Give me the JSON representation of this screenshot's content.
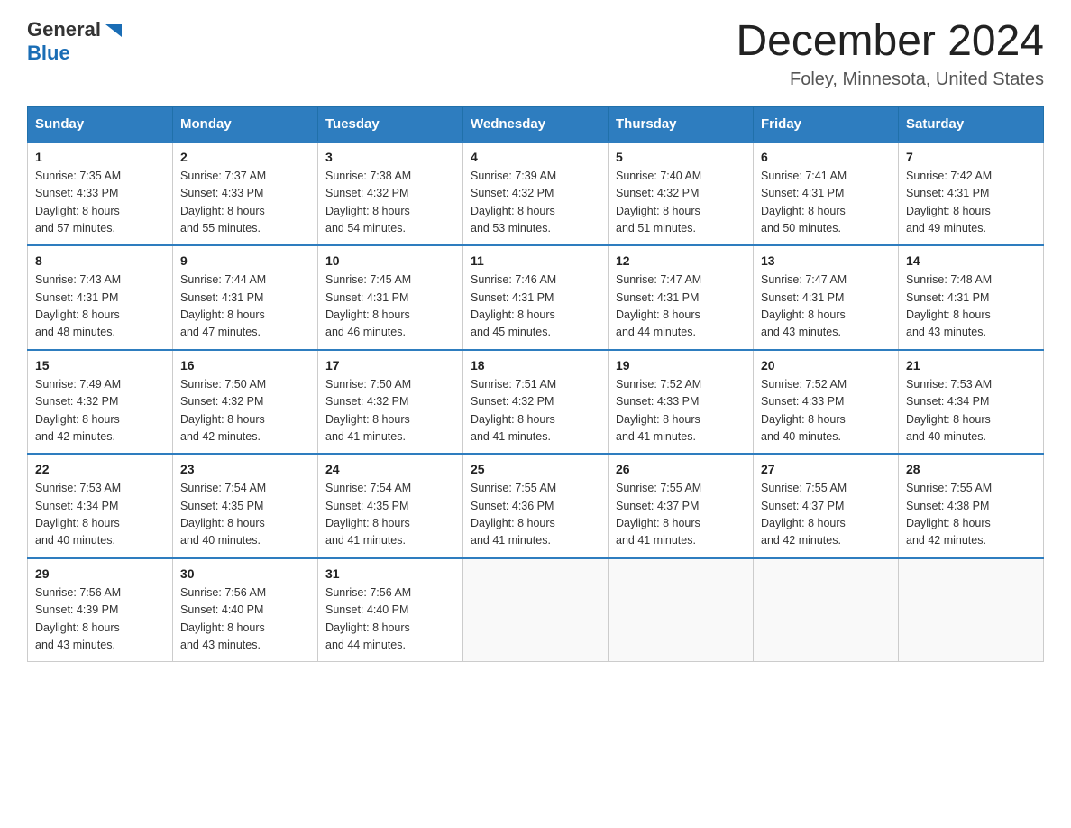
{
  "header": {
    "logo": {
      "general": "General",
      "blue": "Blue"
    },
    "month_title": "December 2024",
    "location": "Foley, Minnesota, United States"
  },
  "days_of_week": [
    "Sunday",
    "Monday",
    "Tuesday",
    "Wednesday",
    "Thursday",
    "Friday",
    "Saturday"
  ],
  "weeks": [
    [
      {
        "day": "1",
        "sunrise": "7:35 AM",
        "sunset": "4:33 PM",
        "daylight": "8 hours and 57 minutes."
      },
      {
        "day": "2",
        "sunrise": "7:37 AM",
        "sunset": "4:33 PM",
        "daylight": "8 hours and 55 minutes."
      },
      {
        "day": "3",
        "sunrise": "7:38 AM",
        "sunset": "4:32 PM",
        "daylight": "8 hours and 54 minutes."
      },
      {
        "day": "4",
        "sunrise": "7:39 AM",
        "sunset": "4:32 PM",
        "daylight": "8 hours and 53 minutes."
      },
      {
        "day": "5",
        "sunrise": "7:40 AM",
        "sunset": "4:32 PM",
        "daylight": "8 hours and 51 minutes."
      },
      {
        "day": "6",
        "sunrise": "7:41 AM",
        "sunset": "4:31 PM",
        "daylight": "8 hours and 50 minutes."
      },
      {
        "day": "7",
        "sunrise": "7:42 AM",
        "sunset": "4:31 PM",
        "daylight": "8 hours and 49 minutes."
      }
    ],
    [
      {
        "day": "8",
        "sunrise": "7:43 AM",
        "sunset": "4:31 PM",
        "daylight": "8 hours and 48 minutes."
      },
      {
        "day": "9",
        "sunrise": "7:44 AM",
        "sunset": "4:31 PM",
        "daylight": "8 hours and 47 minutes."
      },
      {
        "day": "10",
        "sunrise": "7:45 AM",
        "sunset": "4:31 PM",
        "daylight": "8 hours and 46 minutes."
      },
      {
        "day": "11",
        "sunrise": "7:46 AM",
        "sunset": "4:31 PM",
        "daylight": "8 hours and 45 minutes."
      },
      {
        "day": "12",
        "sunrise": "7:47 AM",
        "sunset": "4:31 PM",
        "daylight": "8 hours and 44 minutes."
      },
      {
        "day": "13",
        "sunrise": "7:47 AM",
        "sunset": "4:31 PM",
        "daylight": "8 hours and 43 minutes."
      },
      {
        "day": "14",
        "sunrise": "7:48 AM",
        "sunset": "4:31 PM",
        "daylight": "8 hours and 43 minutes."
      }
    ],
    [
      {
        "day": "15",
        "sunrise": "7:49 AM",
        "sunset": "4:32 PM",
        "daylight": "8 hours and 42 minutes."
      },
      {
        "day": "16",
        "sunrise": "7:50 AM",
        "sunset": "4:32 PM",
        "daylight": "8 hours and 42 minutes."
      },
      {
        "day": "17",
        "sunrise": "7:50 AM",
        "sunset": "4:32 PM",
        "daylight": "8 hours and 41 minutes."
      },
      {
        "day": "18",
        "sunrise": "7:51 AM",
        "sunset": "4:32 PM",
        "daylight": "8 hours and 41 minutes."
      },
      {
        "day": "19",
        "sunrise": "7:52 AM",
        "sunset": "4:33 PM",
        "daylight": "8 hours and 41 minutes."
      },
      {
        "day": "20",
        "sunrise": "7:52 AM",
        "sunset": "4:33 PM",
        "daylight": "8 hours and 40 minutes."
      },
      {
        "day": "21",
        "sunrise": "7:53 AM",
        "sunset": "4:34 PM",
        "daylight": "8 hours and 40 minutes."
      }
    ],
    [
      {
        "day": "22",
        "sunrise": "7:53 AM",
        "sunset": "4:34 PM",
        "daylight": "8 hours and 40 minutes."
      },
      {
        "day": "23",
        "sunrise": "7:54 AM",
        "sunset": "4:35 PM",
        "daylight": "8 hours and 40 minutes."
      },
      {
        "day": "24",
        "sunrise": "7:54 AM",
        "sunset": "4:35 PM",
        "daylight": "8 hours and 41 minutes."
      },
      {
        "day": "25",
        "sunrise": "7:55 AM",
        "sunset": "4:36 PM",
        "daylight": "8 hours and 41 minutes."
      },
      {
        "day": "26",
        "sunrise": "7:55 AM",
        "sunset": "4:37 PM",
        "daylight": "8 hours and 41 minutes."
      },
      {
        "day": "27",
        "sunrise": "7:55 AM",
        "sunset": "4:37 PM",
        "daylight": "8 hours and 42 minutes."
      },
      {
        "day": "28",
        "sunrise": "7:55 AM",
        "sunset": "4:38 PM",
        "daylight": "8 hours and 42 minutes."
      }
    ],
    [
      {
        "day": "29",
        "sunrise": "7:56 AM",
        "sunset": "4:39 PM",
        "daylight": "8 hours and 43 minutes."
      },
      {
        "day": "30",
        "sunrise": "7:56 AM",
        "sunset": "4:40 PM",
        "daylight": "8 hours and 43 minutes."
      },
      {
        "day": "31",
        "sunrise": "7:56 AM",
        "sunset": "4:40 PM",
        "daylight": "8 hours and 44 minutes."
      },
      null,
      null,
      null,
      null
    ]
  ],
  "labels": {
    "sunrise": "Sunrise:",
    "sunset": "Sunset:",
    "daylight": "Daylight:"
  }
}
